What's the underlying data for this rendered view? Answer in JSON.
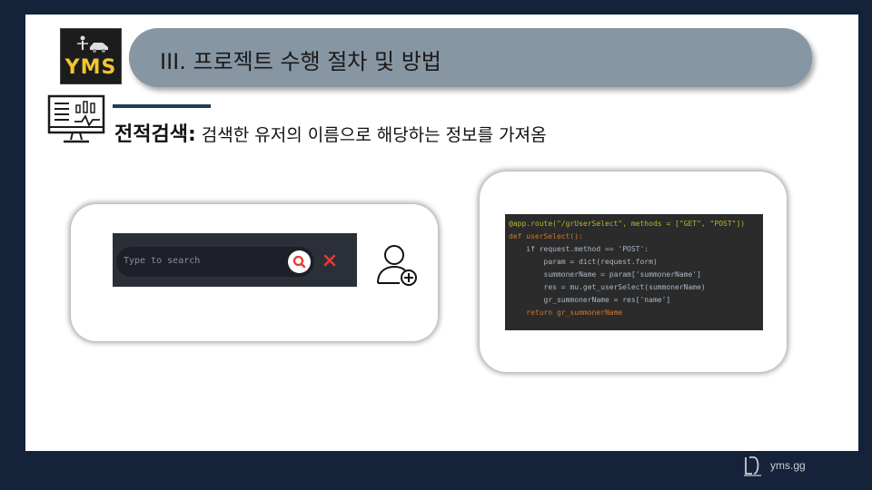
{
  "logo": {
    "text": "YMS"
  },
  "title": "III. 프로젝트 수행 절차 및 방법",
  "section": {
    "heading_bold": "전적검색:",
    "heading_rest": " 검색한 유저의 이름으로 해당하는 정보를 가져옴"
  },
  "search": {
    "placeholder": "Type to search"
  },
  "code_lines": [
    "@app.route(\"/grUserSelect\", methods = [\"GET\", \"POST\"])",
    "def userSelect():",
    "    if request.method == 'POST':",
    "        param = dict(request.form)",
    "        summonerName = param['summonerName']",
    "        res = mu.get_userSelect(summonerName)",
    "        gr_summonerName = res['name']",
    "    return gr_summonerName"
  ],
  "footer": {
    "site": "yms.gg"
  },
  "colors": {
    "background": "#14233a",
    "title_pill": "#8796a3",
    "logo_yellow": "#f2c531",
    "search_btn_icon": "#e53935"
  }
}
